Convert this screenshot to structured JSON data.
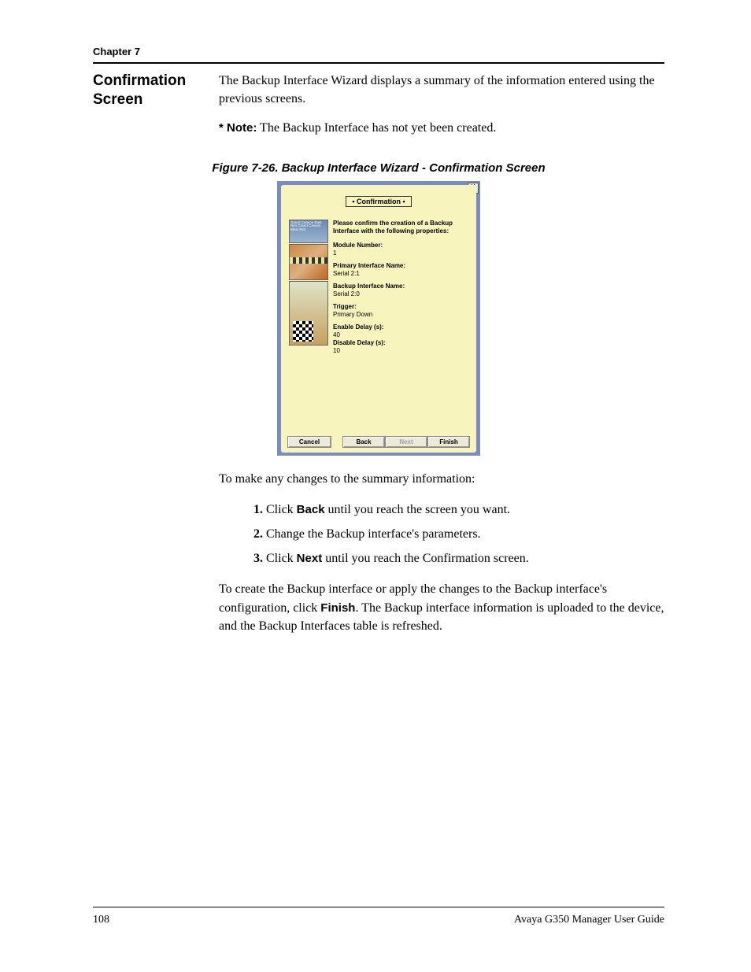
{
  "header": {
    "chapter": "Chapter 7"
  },
  "section": {
    "title": "Confirmation Screen"
  },
  "paragraphs": {
    "intro": "The Backup Interface Wizard displays a summary of the information entered using the previous screens.",
    "note_label": "* Note:",
    "note_text": "  The Backup Interface has not yet been created.",
    "after_figure": "To make any changes to the summary information:",
    "closing_1": "To create the Backup interface or apply the changes to the Backup interface's configuration, click ",
    "closing_finish": "Finish",
    "closing_2": ". The Backup interface information is uploaded to the device, and the Backup Interfaces table is refreshed."
  },
  "figure": {
    "caption": "Figure 7-26.  Backup Interface Wizard - Confirmation Screen",
    "dialog_title": "• Confirmation •",
    "close_glyph": "X",
    "side_text": "Grand Canyon East Rim Grand Canyon West Rim",
    "intro": "Please confirm the creation of a Backup Interface with the following properties:",
    "fields": [
      {
        "label": "Module Number:",
        "value": "1"
      },
      {
        "label": "Primary Interface Name:",
        "value": "Serial 2:1"
      },
      {
        "label": "Backup Interface Name:",
        "value": "Serial 2:0"
      },
      {
        "label": "Trigger:",
        "value": "Primary Down"
      },
      {
        "label": "Enable Delay (s):",
        "value": "40"
      },
      {
        "label": "Disable Delay (s):",
        "value": "10"
      }
    ],
    "buttons": {
      "cancel": "Cancel",
      "back": "Back",
      "next": "Next",
      "finish": "Finish"
    }
  },
  "steps": [
    {
      "num": "1.",
      "pre": "Click ",
      "bold": "Back",
      "post": " until you reach the screen you want."
    },
    {
      "num": "2.",
      "pre": "Change the Backup interface's parameters.",
      "bold": "",
      "post": ""
    },
    {
      "num": "3.",
      "pre": "Click ",
      "bold": "Next",
      "post": " until you reach the Confirmation screen."
    }
  ],
  "footer": {
    "page_number": "108",
    "doc_title": "Avaya G350 Manager User Guide"
  }
}
